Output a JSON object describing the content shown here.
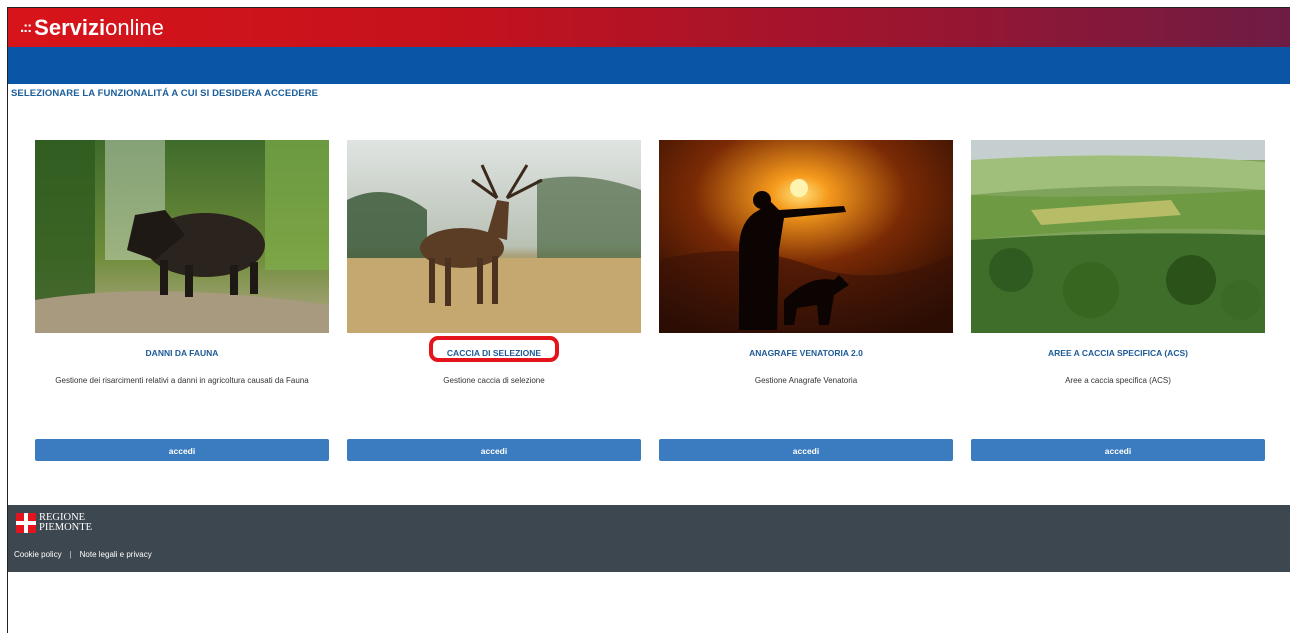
{
  "header": {
    "brand_bold": "Servizi",
    "brand_light": "online",
    "brand_dots": ".::",
    "gradient_start": "#d7141a",
    "gradient_end": "#6e1c44"
  },
  "nav_bar_color": "#0b55a7",
  "prompt": "SELEZIONARE LA FUNZIONALITÁ A CUI SI DESIDERA ACCEDERE",
  "cards": [
    {
      "image_icon": "boar-photo-icon",
      "title": "DANNI DA FAUNA",
      "description": "Gestione dei risarcimenti relativi a danni in agricoltura causati da Fauna",
      "button": "accedi"
    },
    {
      "image_icon": "deer-photo-icon",
      "title": "CACCIA DI SELEZIONE",
      "description": "Gestione caccia di selezione",
      "button": "accedi",
      "highlighted": true
    },
    {
      "image_icon": "hunter-sunset-photo-icon",
      "title": "ANAGRAFE VENATORIA 2.0",
      "description": "Gestione Anagrafe Venatoria",
      "button": "accedi"
    },
    {
      "image_icon": "landscape-photo-icon",
      "title": "AREE A CACCIA SPECIFICA (ACS)",
      "description": "Aree a caccia specifica (ACS)",
      "button": "accedi"
    }
  ],
  "accent_colors": {
    "button": "#3a7cbf",
    "title": "#1c5a96",
    "highlight": "#e3141c",
    "footer": "#3c474f"
  },
  "footer": {
    "logo_line1": "REGIONE",
    "logo_line2": "PIEMONTE",
    "links": [
      "Cookie policy",
      "Note legali e privacy"
    ],
    "separator": "|"
  }
}
